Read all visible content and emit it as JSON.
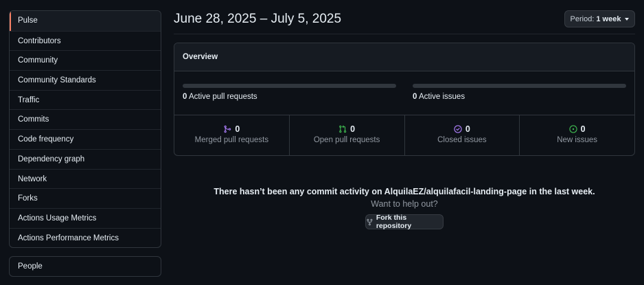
{
  "sidebar": {
    "items": [
      {
        "label": "Pulse",
        "selected": true
      },
      {
        "label": "Contributors"
      },
      {
        "label": "Community"
      },
      {
        "label": "Community Standards"
      },
      {
        "label": "Traffic"
      },
      {
        "label": "Commits"
      },
      {
        "label": "Code frequency"
      },
      {
        "label": "Dependency graph"
      },
      {
        "label": "Network"
      },
      {
        "label": "Forks"
      },
      {
        "label": "Actions Usage Metrics"
      },
      {
        "label": "Actions Performance Metrics"
      }
    ],
    "secondary": {
      "label": "People"
    }
  },
  "header": {
    "date_range": "June 28, 2025 – July 5, 2025",
    "period_label": "Period:",
    "period_value": "1 week"
  },
  "overview": {
    "title": "Overview",
    "active_prs_count": "0",
    "active_prs_label": "Active pull requests",
    "active_issues_count": "0",
    "active_issues_label": "Active issues",
    "stats": {
      "merged": {
        "count": "0",
        "label": "Merged pull requests",
        "icon": "merge-icon",
        "color": "#ab7df8"
      },
      "open": {
        "count": "0",
        "label": "Open pull requests",
        "icon": "pull-request-icon",
        "color": "#3fb950"
      },
      "closed": {
        "count": "0",
        "label": "Closed issues",
        "icon": "issue-closed-icon",
        "color": "#ab7df8"
      },
      "new": {
        "count": "0",
        "label": "New issues",
        "icon": "issue-opened-icon",
        "color": "#3fb950"
      }
    }
  },
  "empty_state": {
    "title": "There hasn’t been any commit activity on AlquilaEZ/alquilafacil-landing-page in the last week.",
    "subtitle": "Want to help out?",
    "fork_button": "Fork this repository"
  }
}
